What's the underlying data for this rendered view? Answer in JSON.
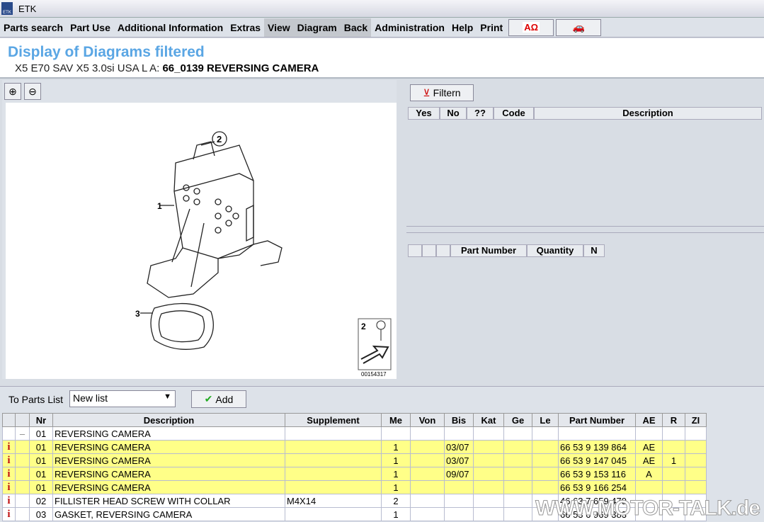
{
  "app": {
    "title": "ETK"
  },
  "menu": [
    "Parts search",
    "Part Use",
    "Additional Information",
    "Extras",
    "View",
    "Diagram",
    "Back",
    "Administration",
    "Help",
    "Print"
  ],
  "toolbar_icons": [
    "language-icon",
    "vehicle-icon"
  ],
  "header": {
    "title": "Display of Diagrams filtered",
    "vehicle": "X5 E70 SAV X5 3.0si USA  L A:",
    "diagram": "66_0139 REVERSING CAMERA"
  },
  "diagram": {
    "callouts": [
      "1",
      "2",
      "3"
    ],
    "legend_number": "2",
    "image_id": "00154317"
  },
  "filter": {
    "button": "Filtern",
    "columns": [
      "Yes",
      "No",
      "??",
      "Code",
      "Description"
    ]
  },
  "parts_panel": {
    "columns": [
      "",
      "",
      "",
      "Part Number",
      "Quantity",
      "N"
    ]
  },
  "parts_list": {
    "label": "To Parts List",
    "selected": "New list",
    "add_button": "Add"
  },
  "table": {
    "columns": [
      "",
      "",
      "Nr",
      "Description",
      "Supplement",
      "Me",
      "Von",
      "Bis",
      "Kat",
      "Ge",
      "Le",
      "Part Number",
      "AE",
      "R",
      "ZI"
    ],
    "rows": [
      {
        "icon": "",
        "mark": "–",
        "nr": "01",
        "desc": "REVERSING CAMERA",
        "sup": "",
        "me": "",
        "von": "",
        "bis": "",
        "kat": "",
        "ge": "",
        "le": "",
        "pn": "",
        "ae": "",
        "r": "",
        "zi": "",
        "hl": false
      },
      {
        "icon": "i",
        "mark": "",
        "nr": "01",
        "desc": "REVERSING CAMERA",
        "sup": "",
        "me": "1",
        "von": "",
        "bis": "03/07",
        "kat": "",
        "ge": "",
        "le": "",
        "pn": "66 53 9 139 864",
        "ae": "AE",
        "r": "",
        "zi": "",
        "hl": true
      },
      {
        "icon": "i",
        "mark": "",
        "nr": "01",
        "desc": "REVERSING CAMERA",
        "sup": "",
        "me": "1",
        "von": "",
        "bis": "03/07",
        "kat": "",
        "ge": "",
        "le": "",
        "pn": "66 53 9 147 045",
        "ae": "AE",
        "r": "1",
        "zi": "",
        "hl": true
      },
      {
        "icon": "i",
        "mark": "",
        "nr": "01",
        "desc": "REVERSING CAMERA",
        "sup": "",
        "me": "1",
        "von": "",
        "bis": "09/07",
        "kat": "",
        "ge": "",
        "le": "",
        "pn": "66 53 9 153 116",
        "ae": "A",
        "r": "",
        "zi": "",
        "hl": true
      },
      {
        "icon": "i",
        "mark": "",
        "nr": "01",
        "desc": "REVERSING CAMERA",
        "sup": "",
        "me": "1",
        "von": "",
        "bis": "",
        "kat": "",
        "ge": "",
        "le": "",
        "pn": "66 53 9 166 254",
        "ae": "",
        "r": "",
        "zi": "",
        "hl": true
      },
      {
        "icon": "i",
        "mark": "",
        "nr": "02",
        "desc": "FILLISTER HEAD SCREW WITH COLLAR",
        "sup": "M4X14",
        "me": "2",
        "von": "",
        "bis": "",
        "kat": "",
        "ge": "",
        "le": "",
        "pn": "46 63 7 659 479",
        "ae": "",
        "r": "",
        "zi": "",
        "hl": false
      },
      {
        "icon": "i",
        "mark": "",
        "nr": "03",
        "desc": "GASKET, REVERSING CAMERA",
        "sup": "",
        "me": "1",
        "von": "",
        "bis": "",
        "kat": "",
        "ge": "",
        "le": "",
        "pn": "66 53 6 969 383",
        "ae": "",
        "r": "",
        "zi": "",
        "hl": false
      }
    ]
  },
  "watermark": "WWW.MOTOR-TALK.de"
}
